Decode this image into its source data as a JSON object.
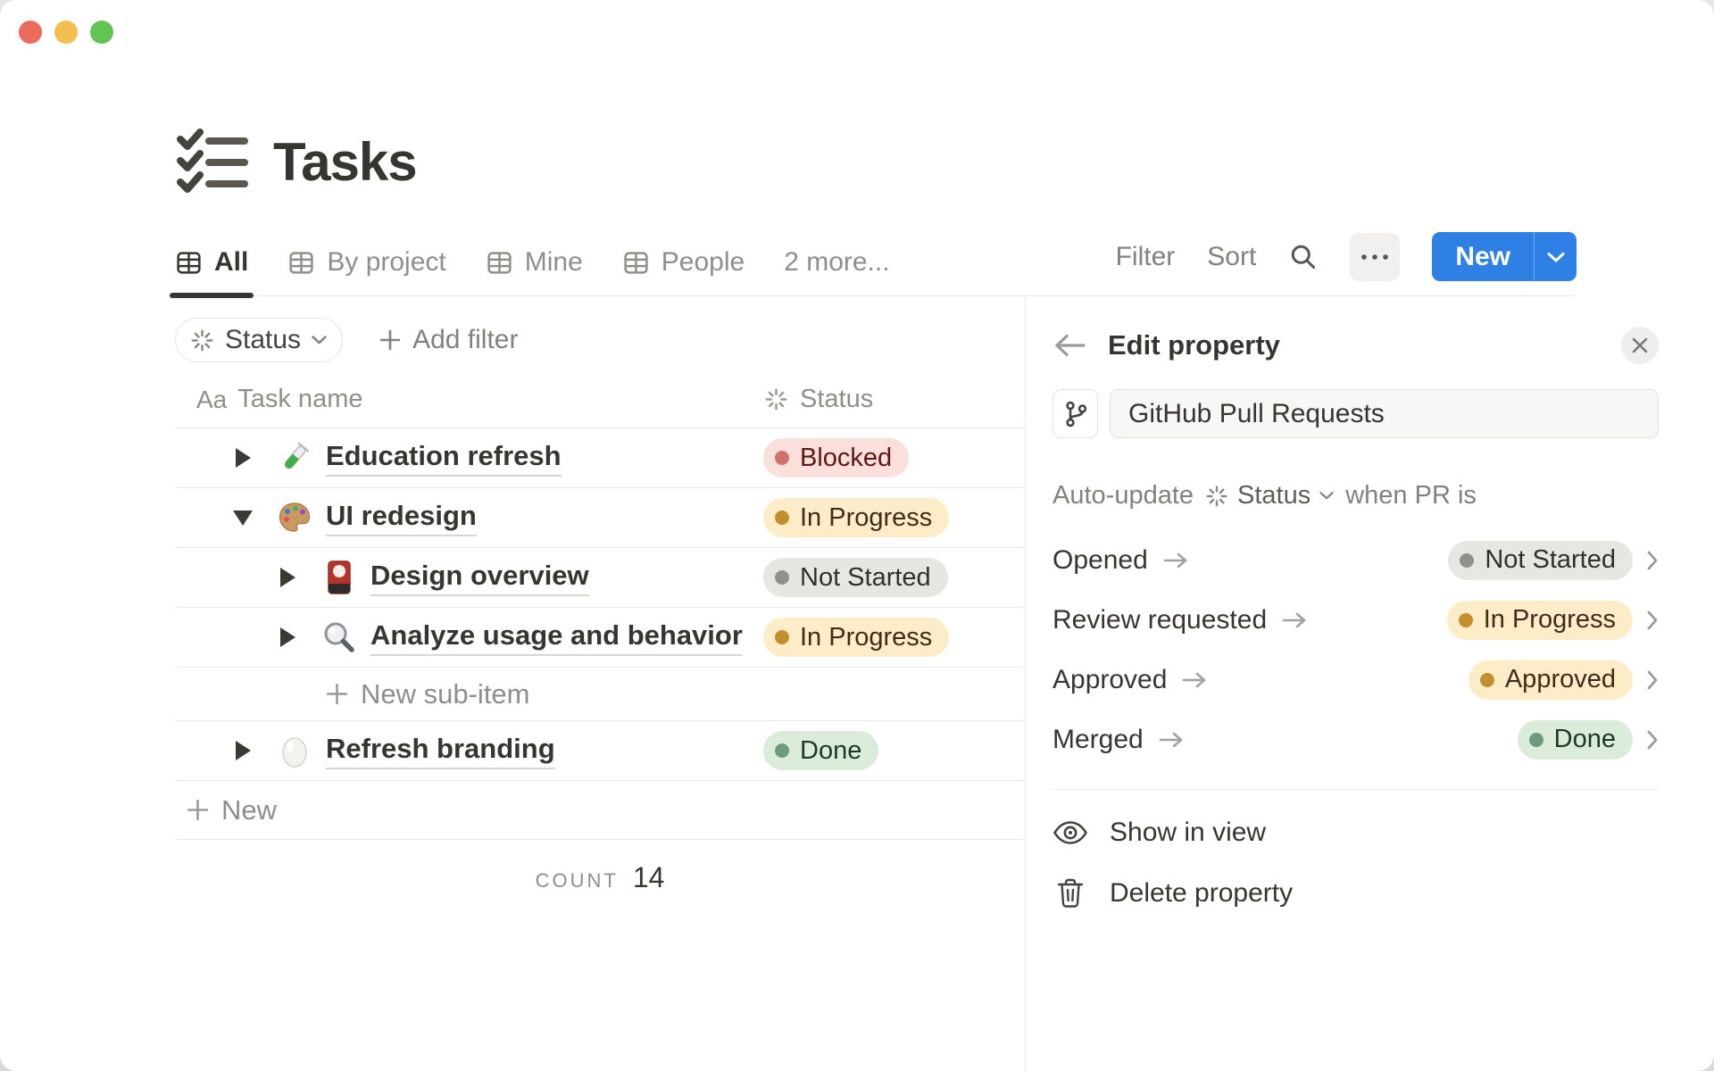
{
  "window_controls": {
    "close": "close-window",
    "minimize": "minimize-window",
    "zoom": "zoom-window",
    "colors": {
      "close": "#ec6a5e",
      "minimize": "#f4bf4f",
      "zoom": "#61c554"
    }
  },
  "page": {
    "title": "Tasks",
    "title_icon": "checklist-icon"
  },
  "tabs": {
    "items": [
      {
        "label": "All",
        "icon": "table-grid-icon",
        "active": true
      },
      {
        "label": "By project",
        "icon": "table-grid-icon",
        "active": false
      },
      {
        "label": "Mine",
        "icon": "table-grid-icon",
        "active": false
      },
      {
        "label": "People",
        "icon": "table-grid-icon",
        "active": false
      },
      {
        "label": "2 more...",
        "icon": null,
        "active": false
      }
    ]
  },
  "toolbar": {
    "filter_label": "Filter",
    "sort_label": "Sort",
    "search_icon": "search-icon",
    "more_icon": "ellipsis-icon",
    "new_label": "New",
    "new_caret_icon": "chevron-down-icon",
    "accent_color": "#2e80e5"
  },
  "filter_bar": {
    "status_chip": {
      "icon": "status-spinner-icon",
      "label": "Status",
      "caret_icon": "chevron-down-icon"
    },
    "add_filter_label": "Add filter"
  },
  "table": {
    "columns": [
      {
        "icon": "Aa",
        "label": "Task name"
      },
      {
        "icon": "status-spinner-icon",
        "label": "Status"
      }
    ],
    "rows": [
      {
        "level": 0,
        "expander": "collapsed",
        "icon": "test-tube-emoji",
        "name": "Education refresh",
        "status": {
          "label": "Blocked",
          "color": "red"
        }
      },
      {
        "level": 0,
        "expander": "expanded",
        "icon": "palette-emoji",
        "name": "UI redesign",
        "status": {
          "label": "In Progress",
          "color": "yellow"
        }
      },
      {
        "level": 1,
        "expander": "collapsed",
        "icon": "flower-card-emoji",
        "name": "Design overview",
        "status": {
          "label": "Not Started",
          "color": "gray"
        }
      },
      {
        "level": 1,
        "expander": "collapsed",
        "icon": "magnifier-emoji",
        "name": "Analyze usage and behavior",
        "status": {
          "label": "In Progress",
          "color": "yellow"
        }
      },
      {
        "level": 0,
        "expander": "collapsed",
        "icon": "egg-emoji",
        "name": "Refresh branding",
        "status": {
          "label": "Done",
          "color": "green"
        }
      }
    ],
    "new_sub_item_label": "New sub-item",
    "new_row_label": "New",
    "count_label": "COUNT",
    "count_value": "14"
  },
  "panel": {
    "back_icon": "back-arrow-icon",
    "title": "Edit property",
    "close_icon": "close-icon",
    "type_icon": "git-branch-icon",
    "name_value": "GitHub Pull Requests",
    "auto_update": {
      "prefix": "Auto-update",
      "property_icon": "status-spinner-icon",
      "property": "Status",
      "caret_icon": "chevron-down-icon",
      "suffix": "when PR is"
    },
    "mappings": [
      {
        "event": "Opened",
        "status": {
          "label": "Not Started",
          "color": "gray"
        }
      },
      {
        "event": "Review requested",
        "status": {
          "label": "In Progress",
          "color": "yellow"
        }
      },
      {
        "event": "Approved",
        "status": {
          "label": "Approved",
          "color": "yellow"
        }
      },
      {
        "event": "Merged",
        "status": {
          "label": "Done",
          "color": "green"
        }
      }
    ],
    "actions": [
      {
        "icon": "eye-icon",
        "label": "Show in view"
      },
      {
        "icon": "trash-icon",
        "label": "Delete property"
      }
    ]
  },
  "status_colors": {
    "red": {
      "bg": "#fbdfdb",
      "dot": "#d2706a",
      "text": "#5d1715"
    },
    "yellow": {
      "bg": "#fdecc8",
      "dot": "#c28f2c",
      "text": "#402c1b"
    },
    "gray": {
      "bg": "#e7e6e3",
      "dot": "#91908c",
      "text": "#32302c"
    },
    "green": {
      "bg": "#dcecda",
      "dot": "#6c9b7d",
      "text": "#1c3829"
    }
  }
}
